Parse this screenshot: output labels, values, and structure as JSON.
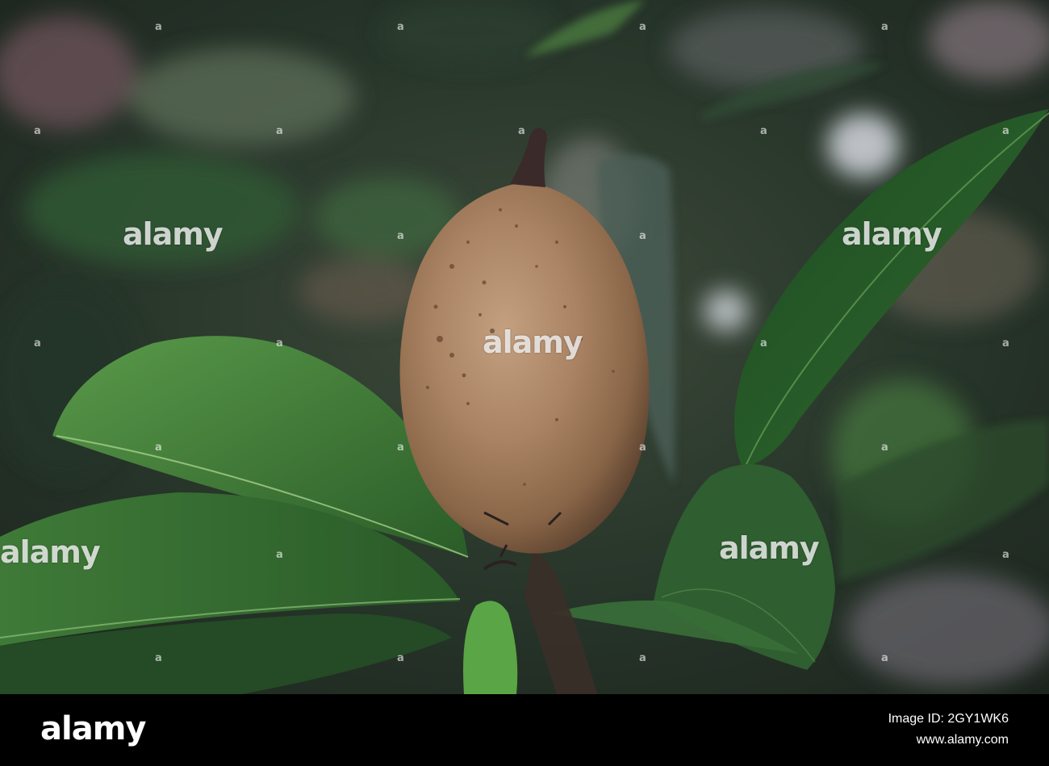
{
  "photo": {
    "subject": "sapodilla-fruit-on-branch",
    "colors": {
      "fruit": "#a07a5a",
      "leaf": "#2f6b2f",
      "leaf_light": "#4f8e3f",
      "background": "#2f3f2f"
    }
  },
  "watermarks": {
    "center_text": "alamy",
    "small_text": "a"
  },
  "footer": {
    "logo": "alamy",
    "image_id": "Image ID: 2GY1WK6",
    "url": "www.alamy.com"
  }
}
